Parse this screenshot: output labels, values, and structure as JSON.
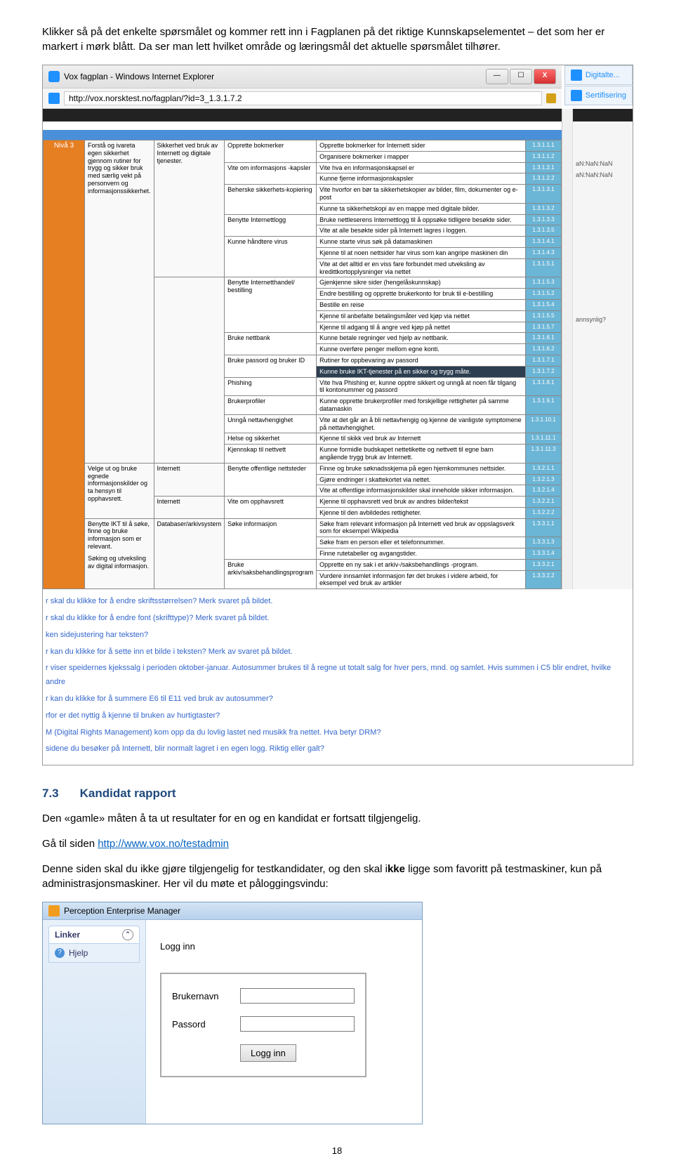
{
  "intro": {
    "p1a": "Klikker så på det enkelte spørsmålet og kommer rett inn i Fagplanen på det riktige Kunnskapselementet – det som her er markert i mørk blått. Da ser man lett hvilket område og læringsmål det aktuelle spørsmålet tilhører."
  },
  "ie": {
    "title": "Vox fagplan - Windows Internet Explorer",
    "url": "http://vox.norsktest.no/fagplan/?id=3_1.3.1.7.2",
    "tabs": [
      "Digitalte...",
      "Sertifisering"
    ]
  },
  "right_strip": {
    "r1": "aN:NaN:NaN",
    "r2": "aN:NaN:NaN",
    "r3": "annsynlig?"
  },
  "level": "Nivå 3",
  "cols": {
    "c1a": "Forstå og ivareta egen sikkerhet gjennom rutiner for trygg og sikker bruk med særlig vekt på personvern og informasjonssikkerhet.",
    "c1b": "Velge ut og bruke egnede informasjonskilder og ta hensyn til opphavsrett.",
    "c1c": "Benytte IKT til å søke, finne og bruke informasjon som er relevant.",
    "c1d": "Søking og utveksling av digital informasjon.",
    "c2a": "Sikkerhet ved bruk av Internett og digitale tjenester.",
    "c2b": "Internett",
    "c2c": "Internett",
    "c2d": "Databaser/arkivsystem"
  },
  "groups": {
    "g1": "Opprette bokmerker",
    "g2": "Vite om informasjons -kapsler",
    "g3": "Beherske sikkerhets-kopiering",
    "g4": "Benytte Internettlogg",
    "g5": "Kunne håndtere virus",
    "g6": "Benytte Internetthandel/ bestilling",
    "g7": "Bruke nettbank",
    "g8": "Bruke passord og bruker ID",
    "g9": "Phishing",
    "g10": "Brukerprofiler",
    "g11": "Unngå nettavhengighet",
    "g12": "Helse og sikkerhet",
    "g13": "Kjennskap til nettvett",
    "g14": "Benytte offentlige nettsteder",
    "g15": "Vite om opphavsrett",
    "g16": "Søke informasjon",
    "g17": "Bruke arkiv/saksbehandlingsprogram"
  },
  "rows": [
    {
      "txt": "Opprette bokmerker for Internett sider",
      "code": "1.3.1.1.1"
    },
    {
      "txt": "Organisere bokmerker i mapper",
      "code": "1.3.1.1.2"
    },
    {
      "txt": "Vite hva en informasjonskapsel er",
      "code": "1.3.1.2.1"
    },
    {
      "txt": "Kunne fjerne informasjonskapsler",
      "code": "1.3.1.2.2"
    },
    {
      "txt": "Vite hvorfor en bør ta sikkerhetskopier av bilder, film, dokumenter og e-post",
      "code": "1.3.1.3.1"
    },
    {
      "txt": "Kunne ta sikkerhetskopi av en mappe med digitale bilder.",
      "code": "1.3.1.3.2"
    },
    {
      "txt": "Bruke nettleserens Internettlogg til å oppsøke tidligere besøkte sider.",
      "code": "1.3.1.3.3"
    },
    {
      "txt": "Vite at alle besøkte sider på Internett lagres i loggen.",
      "code": "1.3.1.3.5"
    },
    {
      "txt": "Kunne starte virus søk på datamaskinen",
      "code": "1.3.1.4.1"
    },
    {
      "txt": "Kjenne til at noen nettsider har virus som kan angripe maskinen din",
      "code": "1.3.1.4.3"
    },
    {
      "txt": "Vite at det alltid er en viss fare forbundet med utveksling av kredittkortopplysninger via nettet",
      "code": "1.3.1.5.1"
    },
    {
      "txt": "Gjenkjenne sikre sider (hengelåskunnskap)",
      "code": "1.3.1.5.3"
    },
    {
      "txt": "Endre bestilling og opprette brukerkonto for bruk til e-bestilling",
      "code": "1.3.1.5.2"
    },
    {
      "txt": "Bestille en reise",
      "code": "1.3.1.5.4"
    },
    {
      "txt": "Kjenne til anbefalte betalingsmåter ved kjøp via nettet",
      "code": "1.3.1.5.5"
    },
    {
      "txt": "Kjenne til adgang til å angre ved kjøp på nettet",
      "code": "1.3.1.5.7"
    },
    {
      "txt": "Kunne betale regninger ved hjelp av nettbank.",
      "code": "1.3.1.6.1"
    },
    {
      "txt": "Kunne overføre penger mellom egne konti.",
      "code": "1.3.1.6.2"
    },
    {
      "txt": "Rutiner for oppbevaring av passord",
      "code": "1.3.1.7.1"
    },
    {
      "txt": "Kunne bruke IKT-tjenester på en sikker og trygg måte.",
      "code": "1.3.1.7.2",
      "hl": true
    },
    {
      "txt": "Vite hva Phishing er, kunne opptre sikkert og unngå at noen får tilgang til kontonummer og passord",
      "code": "1.3.1.8.1"
    },
    {
      "txt": "Kunne opprette brukerprofiler med forskjellige rettigheter på samme datamaskin",
      "code": "1.3.1.9.1"
    },
    {
      "txt": "Vite at det går an å bli nettavhengig og kjenne de vanligste symptomene på nettavhengighet.",
      "code": "1.3.1.10.1"
    },
    {
      "txt": "Kjenne til skikk ved bruk av Internett",
      "code": "1.3.1.11.1"
    },
    {
      "txt": "Kunne formidle budskapet nettetikette og nettvett til egne barn angående trygg bruk av Internett.",
      "code": "1.3.1.11.3"
    },
    {
      "txt": "Finne og bruke søknadsskjema på egen hjemkommunes nettsider.",
      "code": "1.3.2.1.1"
    },
    {
      "txt": "Gjøre endringer i skattekortet via nettet.",
      "code": "1.3.2.1.3"
    },
    {
      "txt": "Vite at offentlige informasjonskilder skal inneholde sikker informasjon.",
      "code": "1.3.2.1.4"
    },
    {
      "txt": "Kjenne til opphavsrett ved bruk av andres bilder/tekst",
      "code": "1.3.2.2.1"
    },
    {
      "txt": "Kjenne til den avbildedes rettigheter.",
      "code": "1.3.2.2.2"
    },
    {
      "txt": "Søke fram relevant informasjon på Internett ved bruk av oppslagsverk som for eksempel Wikipedia",
      "code": "1.3.3.1.1"
    },
    {
      "txt": "Søke fram en person eller et telefonnummer.",
      "code": "1.3.3.1.3"
    },
    {
      "txt": "Finne rutetabeller og avgangstider.",
      "code": "1.3.3.1.4"
    },
    {
      "txt": "Opprette en ny sak i et arkiv-/saksbehandlings -program.",
      "code": "1.3.3.2.1"
    },
    {
      "txt": "Vurdere innsamlet informasjon før det brukes i videre arbeid, for eksempel ved bruk av artikler",
      "code": "1.3.3.2.2"
    }
  ],
  "questions": [
    "r skal du klikke for å endre skriftsstørrelsen? Merk svaret på bildet.",
    "r skal du klikke for å endre font (skrifttype)? Merk svaret på bildet.",
    "ken sidejustering har teksten?",
    "r kan du klikke for å sette inn et bilde i teksten? Merk av svaret på bildet.",
    "r viser speidernes kjekssalg i perioden oktober-januar. Autosummer brukes til å regne ut totalt salg for hver pers, mnd. og samlet. Hvis summen i C5 blir endret, hvilke andre",
    "r kan du klikke for å summere E6 til E11 ved bruk av autosummer?",
    "rfor er det nyttig å kjenne til bruken av hurtigtaster?",
    "M (Digital Rights Management) kom opp da du lovlig lastet ned musikk fra nettet. Hva betyr DRM?",
    "sidene du besøker på Internett, blir normalt lagret i en egen logg. Riktig eller galt?"
  ],
  "section73": {
    "num": "7.3",
    "title": "Kandidat rapport",
    "p1": "Den «gamle» måten å ta ut resultater for en og en kandidat er fortsatt tilgjengelig.",
    "p2a": "Gå til siden ",
    "link": "http://www.vox.no/testadmin",
    "p3a": "Denne siden skal du ikke gjøre tilgjengelig for testkandidater, og den skal i",
    "p3b": "kke",
    "p3c": " ligge som favoritt på testmaskiner, kun på administrasjonsmaskiner. Her vil du møte et påloggingsvindu:"
  },
  "login": {
    "title": "Perception Enterprise Manager",
    "linker": "Linker",
    "hjelp": "Hjelp",
    "logg_inn": "Logg inn",
    "user": "Brukernavn",
    "pass": "Passord",
    "btn": "Logg inn"
  },
  "page_num": "18"
}
